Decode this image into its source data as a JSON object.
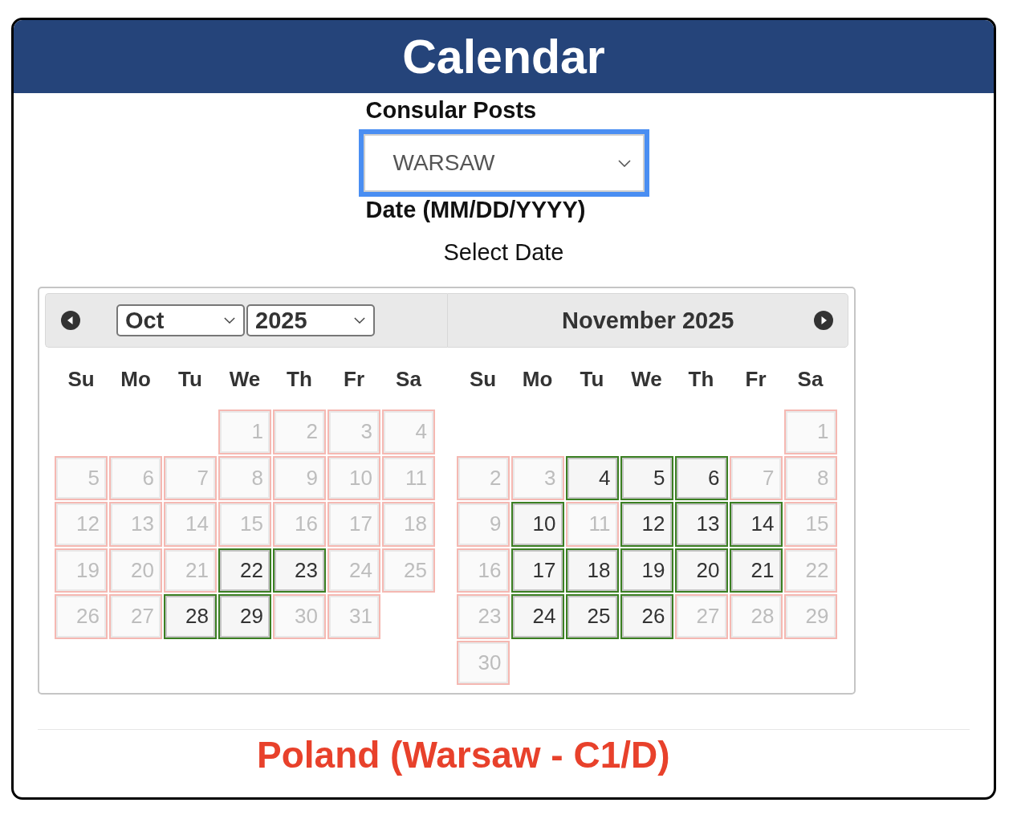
{
  "window": {
    "title": "Calendar"
  },
  "form": {
    "consular_posts": {
      "label": "Consular Posts",
      "value": "WARSAW",
      "focused": true
    },
    "date": {
      "label": "Date (MM/DD/YYYY)",
      "prompt": "Select Date"
    }
  },
  "datepicker": {
    "months": [
      {
        "header": {
          "kind": "selects",
          "month": "Oct",
          "year": "2025"
        },
        "weekdays": [
          "Su",
          "Mo",
          "Tu",
          "We",
          "Th",
          "Fr",
          "Sa"
        ],
        "first_week_right_aligned": true,
        "weeks": [
          {
            "days": [
              {
                "day": "1",
                "available": false
              },
              {
                "day": "2",
                "available": false
              },
              {
                "day": "3",
                "available": false
              },
              {
                "day": "4",
                "available": false
              }
            ]
          },
          {
            "days": [
              {
                "day": "5",
                "available": false
              },
              {
                "day": "6",
                "available": false
              },
              {
                "day": "7",
                "available": false
              },
              {
                "day": "8",
                "available": false
              },
              {
                "day": "9",
                "available": false
              },
              {
                "day": "10",
                "available": false
              },
              {
                "day": "11",
                "available": false
              }
            ]
          },
          {
            "days": [
              {
                "day": "12",
                "available": false
              },
              {
                "day": "13",
                "available": false
              },
              {
                "day": "14",
                "available": false
              },
              {
                "day": "15",
                "available": false
              },
              {
                "day": "16",
                "available": false
              },
              {
                "day": "17",
                "available": false
              },
              {
                "day": "18",
                "available": false
              }
            ]
          },
          {
            "days": [
              {
                "day": "19",
                "available": false
              },
              {
                "day": "20",
                "available": false
              },
              {
                "day": "21",
                "available": false
              },
              {
                "day": "22",
                "available": true
              },
              {
                "day": "23",
                "available": true
              },
              {
                "day": "24",
                "available": false
              },
              {
                "day": "25",
                "available": false
              }
            ]
          },
          {
            "days": [
              {
                "day": "26",
                "available": false
              },
              {
                "day": "27",
                "available": false
              },
              {
                "day": "28",
                "available": true
              },
              {
                "day": "29",
                "available": true
              },
              {
                "day": "30",
                "available": false
              },
              {
                "day": "31",
                "available": false
              }
            ]
          }
        ]
      },
      {
        "header": {
          "kind": "title",
          "title": "November 2025"
        },
        "weekdays": [
          "Su",
          "Mo",
          "Tu",
          "We",
          "Th",
          "Fr",
          "Sa"
        ],
        "first_week_right_aligned": true,
        "weeks": [
          {
            "days": [
              {
                "day": "1",
                "available": false
              }
            ]
          },
          {
            "days": [
              {
                "day": "2",
                "available": false
              },
              {
                "day": "3",
                "available": false
              },
              {
                "day": "4",
                "available": true
              },
              {
                "day": "5",
                "available": true
              },
              {
                "day": "6",
                "available": true
              },
              {
                "day": "7",
                "available": false
              },
              {
                "day": "8",
                "available": false
              }
            ]
          },
          {
            "days": [
              {
                "day": "9",
                "available": false
              },
              {
                "day": "10",
                "available": true
              },
              {
                "day": "11",
                "available": false
              },
              {
                "day": "12",
                "available": true
              },
              {
                "day": "13",
                "available": true
              },
              {
                "day": "14",
                "available": true
              },
              {
                "day": "15",
                "available": false
              }
            ]
          },
          {
            "days": [
              {
                "day": "16",
                "available": false
              },
              {
                "day": "17",
                "available": true
              },
              {
                "day": "18",
                "available": true
              },
              {
                "day": "19",
                "available": true
              },
              {
                "day": "20",
                "available": true
              },
              {
                "day": "21",
                "available": true
              },
              {
                "day": "22",
                "available": false
              }
            ]
          },
          {
            "days": [
              {
                "day": "23",
                "available": false
              },
              {
                "day": "24",
                "available": true
              },
              {
                "day": "25",
                "available": true
              },
              {
                "day": "26",
                "available": true
              },
              {
                "day": "27",
                "available": false
              },
              {
                "day": "28",
                "available": false
              },
              {
                "day": "29",
                "available": false
              }
            ]
          },
          {
            "days": [
              {
                "day": "30",
                "available": false
              }
            ]
          }
        ]
      }
    ]
  },
  "footer": {
    "title": "Poland (Warsaw - C1/D)"
  }
}
